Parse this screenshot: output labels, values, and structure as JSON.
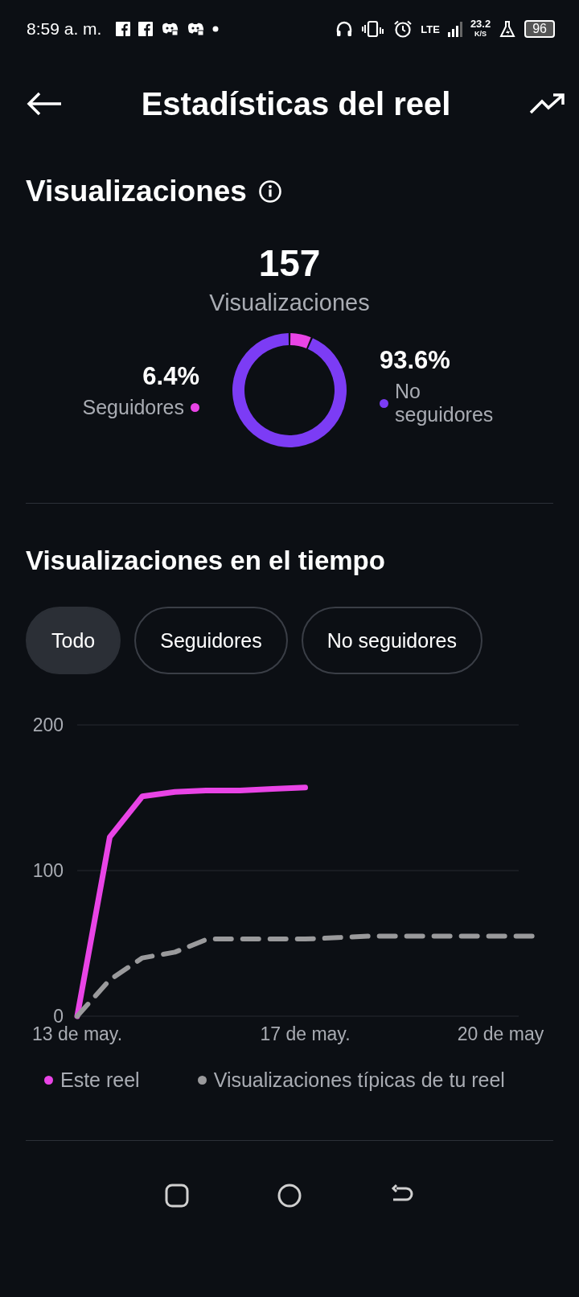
{
  "status_bar": {
    "time": "8:59 a. m.",
    "network": "LTE",
    "speed": "23.2",
    "speed_unit": "K/S",
    "battery": "96"
  },
  "header": {
    "title": "Estadísticas del reel"
  },
  "views": {
    "heading": "Visualizaciones",
    "total": "157",
    "total_label": "Visualizaciones",
    "breakdown": [
      {
        "percent": "6.4%",
        "color": "#e944e6"
      },
      {
        "percent": "93.6%",
        "color": "#7c3cf5"
      }
    ],
    "chart_data": {
      "type": "donut",
      "categories": [
        "Seguidores",
        "No seguidores"
      ],
      "values": [
        6.4,
        93.6
      ]
    }
  },
  "over_time": {
    "heading": "Visualizaciones en el tiempo",
    "filters": [
      {
        "label": "Todo",
        "selected": true
      },
      {
        "label": "Seguidores",
        "selected": false
      },
      {
        "label": "No seguidores",
        "selected": false
      }
    ],
    "chart_data": {
      "type": "line",
      "categories": [
        "13 de may.",
        null,
        null,
        null,
        null,
        null,
        null,
        "17 de may.",
        null,
        null,
        null,
        null,
        null,
        "20 de may",
        null
      ],
      "series": [
        {
          "name": "Este reel",
          "color": "#e944e6",
          "line_style": "solid",
          "values": [
            0,
            123,
            151,
            154,
            155,
            155,
            156,
            157,
            null,
            null,
            null,
            null,
            null,
            null,
            null
          ]
        },
        {
          "name": "Visualizaciones típicas de tu reel",
          "color": "#9a9a9c",
          "line_style": "dashed",
          "values": [
            0,
            25,
            40,
            44,
            53,
            53,
            53,
            53,
            54,
            55,
            55,
            55,
            55,
            55,
            55
          ]
        }
      ],
      "ylim": [
        0,
        200
      ],
      "yticks": [
        0,
        100,
        200
      ]
    }
  }
}
